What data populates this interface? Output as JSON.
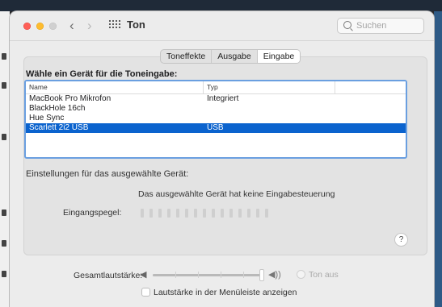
{
  "window": {
    "title": "Ton",
    "search_placeholder": "Suchen"
  },
  "tabs": [
    {
      "label": "Toneffekte",
      "active": false
    },
    {
      "label": "Ausgabe",
      "active": false
    },
    {
      "label": "Eingabe",
      "active": true
    }
  ],
  "input": {
    "heading": "Wähle ein Gerät für die Toneingabe:",
    "columns": [
      "Name",
      "Typ"
    ],
    "devices": [
      {
        "name": "MacBook Pro Mikrofon",
        "type": "Integriert",
        "selected": false
      },
      {
        "name": "BlackHole 16ch",
        "type": "",
        "selected": false
      },
      {
        "name": "Hue Sync",
        "type": "",
        "selected": false
      },
      {
        "name": "Scarlett 2i2 USB",
        "type": "USB",
        "selected": true
      }
    ],
    "settings_label": "Einstellungen für das ausgewählte Gerät:",
    "no_control_text": "Das ausgewählte Gerät hat keine Eingabesteuerung",
    "level_label": "Eingangspegel:",
    "level_segments": 15,
    "level_active": 0,
    "help_label": "?"
  },
  "footer": {
    "volume_label": "Gesamtlautstärke:",
    "volume_fraction": 1.0,
    "mute_label": "Ton aus",
    "mute_checked": false,
    "menubar_label": "Lautstärke in der Menüleiste anzeigen",
    "menubar_checked": false
  },
  "colors": {
    "selection": "#0b63ce",
    "focus_ring": "#6a9fe0",
    "close": "#fe5f57",
    "minimize": "#febc2e"
  },
  "icons": {
    "back": "‹",
    "forward": "›",
    "volume_low": "◀",
    "volume_high": "◀))"
  }
}
